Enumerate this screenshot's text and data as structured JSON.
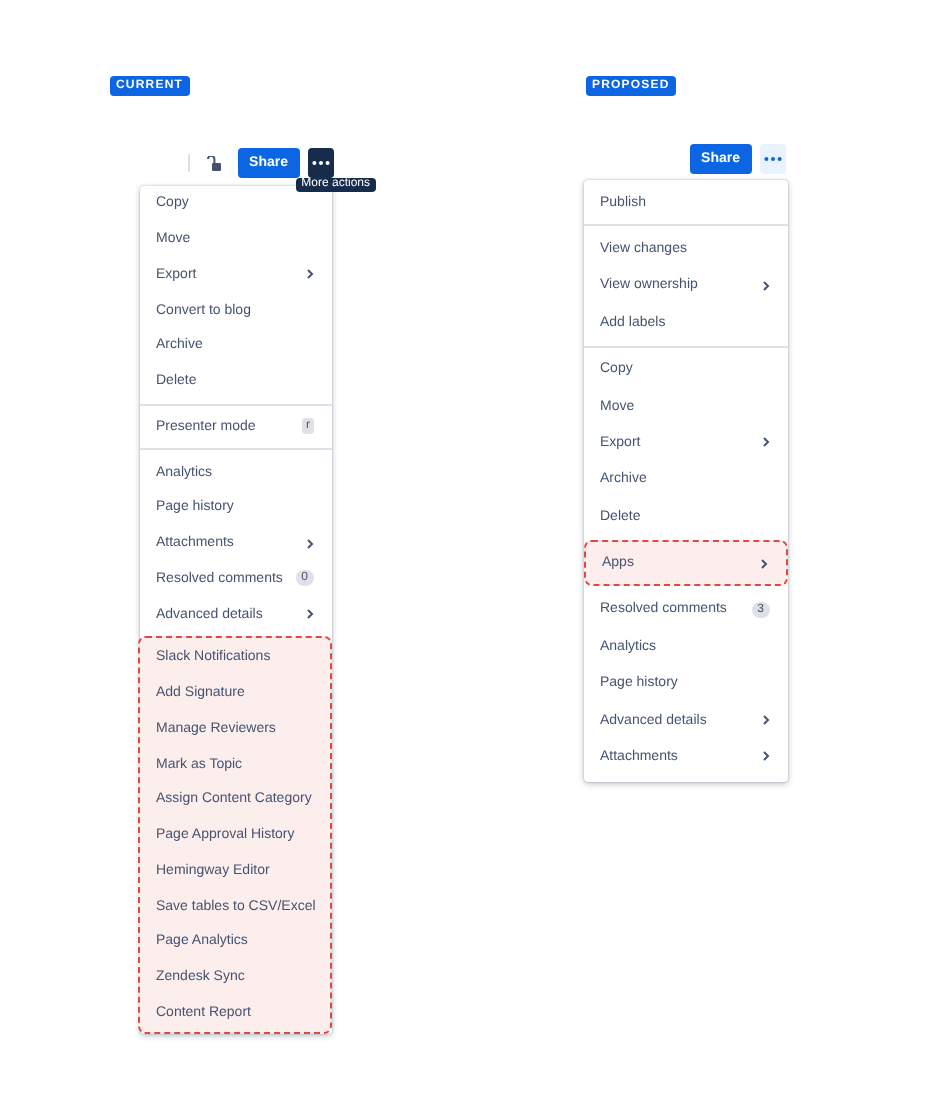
{
  "panels": [
    {
      "label": "CURRENT",
      "toolbar": [
        {
          "kind": "lock"
        },
        {
          "kind": "share",
          "label": "Share"
        },
        {
          "kind": "more",
          "pressed": true,
          "tooltip": "More actions"
        }
      ],
      "menu": [
        {
          "highlighted": false,
          "items": [
            {
              "kind": "plain",
              "label": "Copy"
            },
            {
              "kind": "plain",
              "label": "Move"
            },
            {
              "kind": "submenu",
              "label": "Export"
            },
            {
              "kind": "plain",
              "label": "Convert to blog"
            },
            {
              "kind": "plain",
              "label": "Archive"
            },
            {
              "kind": "plain",
              "label": "Delete"
            }
          ]
        },
        {
          "highlighted": false,
          "items": [
            {
              "kind": "shortcut",
              "label": "Presenter mode",
              "key": "r"
            }
          ]
        },
        {
          "highlighted": false,
          "items": [
            {
              "kind": "plain",
              "label": "Analytics"
            },
            {
              "kind": "plain",
              "label": "Page history"
            },
            {
              "kind": "submenu",
              "label": "Attachments"
            },
            {
              "kind": "count",
              "label": "Resolved comments",
              "count": "0"
            },
            {
              "kind": "submenu",
              "label": "Advanced details"
            }
          ]
        },
        {
          "highlighted": true,
          "items": [
            {
              "kind": "plain",
              "label": "Slack Notifications"
            },
            {
              "kind": "plain",
              "label": "Add Signature"
            },
            {
              "kind": "plain",
              "label": "Manage Reviewers"
            },
            {
              "kind": "plain",
              "label": "Mark as Topic"
            },
            {
              "kind": "plain",
              "label": "Assign Content Category"
            },
            {
              "kind": "plain",
              "label": "Page Approval History"
            },
            {
              "kind": "plain",
              "label": "Hemingway Editor"
            },
            {
              "kind": "plain",
              "label": "Save tables to CSV/Excel"
            },
            {
              "kind": "plain",
              "label": "Page Analytics"
            },
            {
              "kind": "plain",
              "label": "Zendesk Sync"
            },
            {
              "kind": "plain",
              "label": "Content Report"
            }
          ]
        }
      ]
    },
    {
      "label": "PROPOSED",
      "toolbar": [
        {
          "kind": "share",
          "label": "Share"
        },
        {
          "kind": "more",
          "pressed": false
        }
      ],
      "menu": [
        {
          "highlighted": false,
          "items": [
            {
              "kind": "plain",
              "label": "Publish"
            }
          ]
        },
        {
          "highlighted": false,
          "items": [
            {
              "kind": "plain",
              "label": "View changes"
            },
            {
              "kind": "submenu",
              "label": "View ownership"
            },
            {
              "kind": "plain",
              "label": "Add labels"
            }
          ]
        },
        {
          "highlighted": false,
          "items": [
            {
              "kind": "plain",
              "label": "Copy"
            },
            {
              "kind": "plain",
              "label": "Move"
            },
            {
              "kind": "submenu",
              "label": "Export"
            },
            {
              "kind": "plain",
              "label": "Archive"
            },
            {
              "kind": "plain",
              "label": "Delete"
            }
          ]
        },
        {
          "highlighted": true,
          "items": [
            {
              "kind": "submenu",
              "label": "Apps"
            }
          ]
        },
        {
          "highlighted": false,
          "items": [
            {
              "kind": "count",
              "label": "Resolved comments",
              "count": "3"
            },
            {
              "kind": "plain",
              "label": "Analytics"
            },
            {
              "kind": "plain",
              "label": "Page history"
            },
            {
              "kind": "submenu",
              "label": "Advanced details"
            },
            {
              "kind": "submenu",
              "label": "Attachments"
            }
          ]
        }
      ]
    }
  ]
}
